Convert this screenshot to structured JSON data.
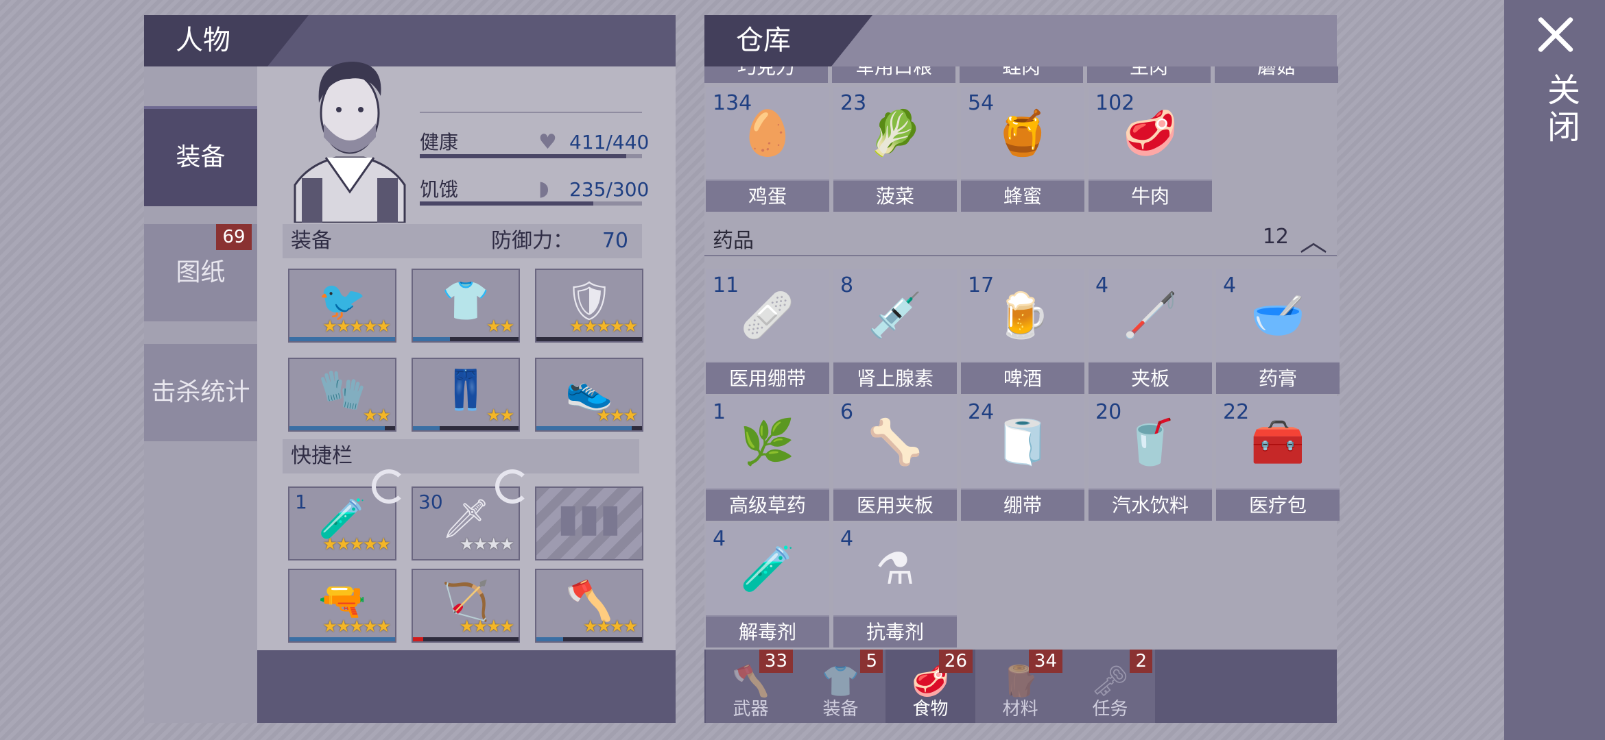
{
  "close": {
    "label": "关闭"
  },
  "character": {
    "tab": "人物",
    "side_tabs": [
      {
        "label": "装备",
        "active": true
      },
      {
        "label": "图纸",
        "badge": "69"
      },
      {
        "label": "击杀统计"
      }
    ],
    "stats": {
      "health_label": "健康",
      "health_value": "411/440",
      "health_fill": 0.93,
      "hunger_label": "饥饿",
      "hunger_value": "235/300",
      "hunger_fill": 0.78
    },
    "equipment": {
      "title": "装备",
      "defense_label": "防御力：",
      "defense_value": "70",
      "slots": [
        {
          "icon": "bird-helmet-icon",
          "glyph": "🐦",
          "stars": 5,
          "durability": 1.0
        },
        {
          "icon": "ornate-armor-icon",
          "glyph": "👕",
          "stars": 2,
          "durability": 0.35
        },
        {
          "icon": "turtle-shell-icon",
          "glyph": "🛡",
          "stars": 5,
          "durability": 0.0
        },
        {
          "icon": "gloves-icon",
          "glyph": "🧤",
          "stars": 2,
          "durability": 0.9
        },
        {
          "icon": "ornate-pants-icon",
          "glyph": "👖",
          "stars": 2,
          "durability": 0.25
        },
        {
          "icon": "sneakers-icon",
          "glyph": "👟",
          "stars": 3,
          "durability": 0.9
        }
      ]
    },
    "quickbar": {
      "title": "快捷栏",
      "slots": [
        {
          "icon": "gas-canisters-icon",
          "glyph": "🧪",
          "count": "1",
          "stars": 5,
          "grey": 0
        },
        {
          "icon": "poison-spear-icon",
          "glyph": "🗡",
          "count": "30",
          "stars": 0,
          "grey": 4
        },
        {
          "icon": "empty-ammo-slot-icon",
          "glyph": "",
          "count": "",
          "stars": 0,
          "grey": 0
        },
        {
          "icon": "revolver-icon",
          "glyph": "🔫",
          "count": "",
          "stars": 5,
          "grey": 0,
          "durability": 1.0
        },
        {
          "icon": "bow-icon",
          "glyph": "🏹",
          "count": "",
          "stars": 4,
          "grey": 0,
          "durability": 0.1,
          "dur_color": "#d11c1c"
        },
        {
          "icon": "axe-icon",
          "glyph": "🪓",
          "count": "",
          "stars": 4,
          "grey": 0,
          "durability": 0.25
        }
      ]
    }
  },
  "warehouse": {
    "tab": "仓库",
    "partial_row": [
      "巧克力",
      "军用口粮",
      "蛙肉",
      "生肉",
      "蘑菇"
    ],
    "food_items": [
      {
        "count": "134",
        "name": "鸡蛋",
        "icon": "eggs-icon",
        "glyph": "🥚"
      },
      {
        "count": "23",
        "name": "菠菜",
        "icon": "spinach-icon",
        "glyph": "🥬"
      },
      {
        "count": "54",
        "name": "蜂蜜",
        "icon": "honeycomb-icon",
        "glyph": "🍯"
      },
      {
        "count": "102",
        "name": "牛肉",
        "icon": "beef-icon",
        "glyph": "🥩"
      }
    ],
    "medicine": {
      "title": "药品",
      "count": "12",
      "items": [
        {
          "count": "11",
          "name": "医用绷带",
          "icon": "medical-bandage-icon",
          "glyph": "🩹"
        },
        {
          "count": "8",
          "name": "肾上腺素",
          "icon": "syringe-icon",
          "glyph": "💉"
        },
        {
          "count": "17",
          "name": "啤酒",
          "icon": "beer-bottle-icon",
          "glyph": "🍺"
        },
        {
          "count": "4",
          "name": "夹板",
          "icon": "splint-icon",
          "glyph": "🦯"
        },
        {
          "count": "4",
          "name": "药膏",
          "icon": "mortar-ointment-icon",
          "glyph": "🥣"
        },
        {
          "count": "1",
          "name": "高级草药",
          "icon": "herbs-icon",
          "glyph": "🌿"
        },
        {
          "count": "6",
          "name": "医用夹板",
          "icon": "medical-splint-icon",
          "glyph": "🦴"
        },
        {
          "count": "24",
          "name": "绷带",
          "icon": "bandage-roll-icon",
          "glyph": "🧻"
        },
        {
          "count": "20",
          "name": "汽水饮料",
          "icon": "soda-bottle-icon",
          "glyph": "🥤"
        },
        {
          "count": "22",
          "name": "医疗包",
          "icon": "medkit-icon",
          "glyph": "🧰"
        },
        {
          "count": "4",
          "name": "解毒剂",
          "icon": "antidote-vial-icon",
          "glyph": "🧪"
        },
        {
          "count": "4",
          "name": "抗毒剂",
          "icon": "antivenom-jar-icon",
          "glyph": "⚗"
        }
      ]
    },
    "tabs": [
      {
        "label": "武器",
        "badge": "33",
        "icon": "axe-tab-icon",
        "glyph": "🪓"
      },
      {
        "label": "装备",
        "badge": "5",
        "icon": "shirt-tab-icon",
        "glyph": "👕"
      },
      {
        "label": "食物",
        "badge": "26",
        "icon": "meat-tab-icon",
        "glyph": "🥩",
        "active": true
      },
      {
        "label": "材料",
        "badge": "34",
        "icon": "plank-tab-icon",
        "glyph": "🪵"
      },
      {
        "label": "任务",
        "badge": "2",
        "icon": "key-tab-icon",
        "glyph": "🗝"
      }
    ]
  }
}
